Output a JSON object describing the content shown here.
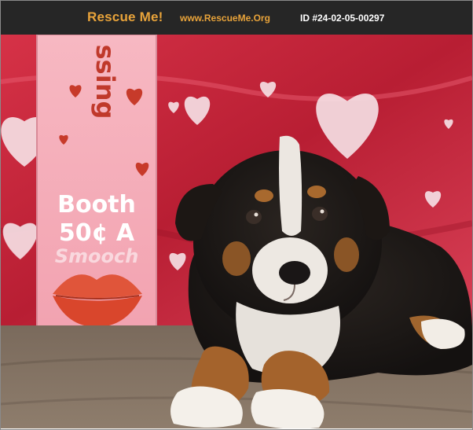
{
  "header": {
    "brand": "Rescue Me!",
    "site": "www.RescueMe.Org",
    "pet_id": "ID #24-02-05-00297"
  },
  "photo": {
    "sign": {
      "line_top": "ssing",
      "word_booth": "Booth",
      "price_line": "50¢ A",
      "word_smooch": "Smooch"
    }
  },
  "colors": {
    "header_bg": "#262626",
    "brand_orange": "#e8a33a",
    "backdrop_red": "#c8283c",
    "sign_pink": "#f4a7b4"
  }
}
